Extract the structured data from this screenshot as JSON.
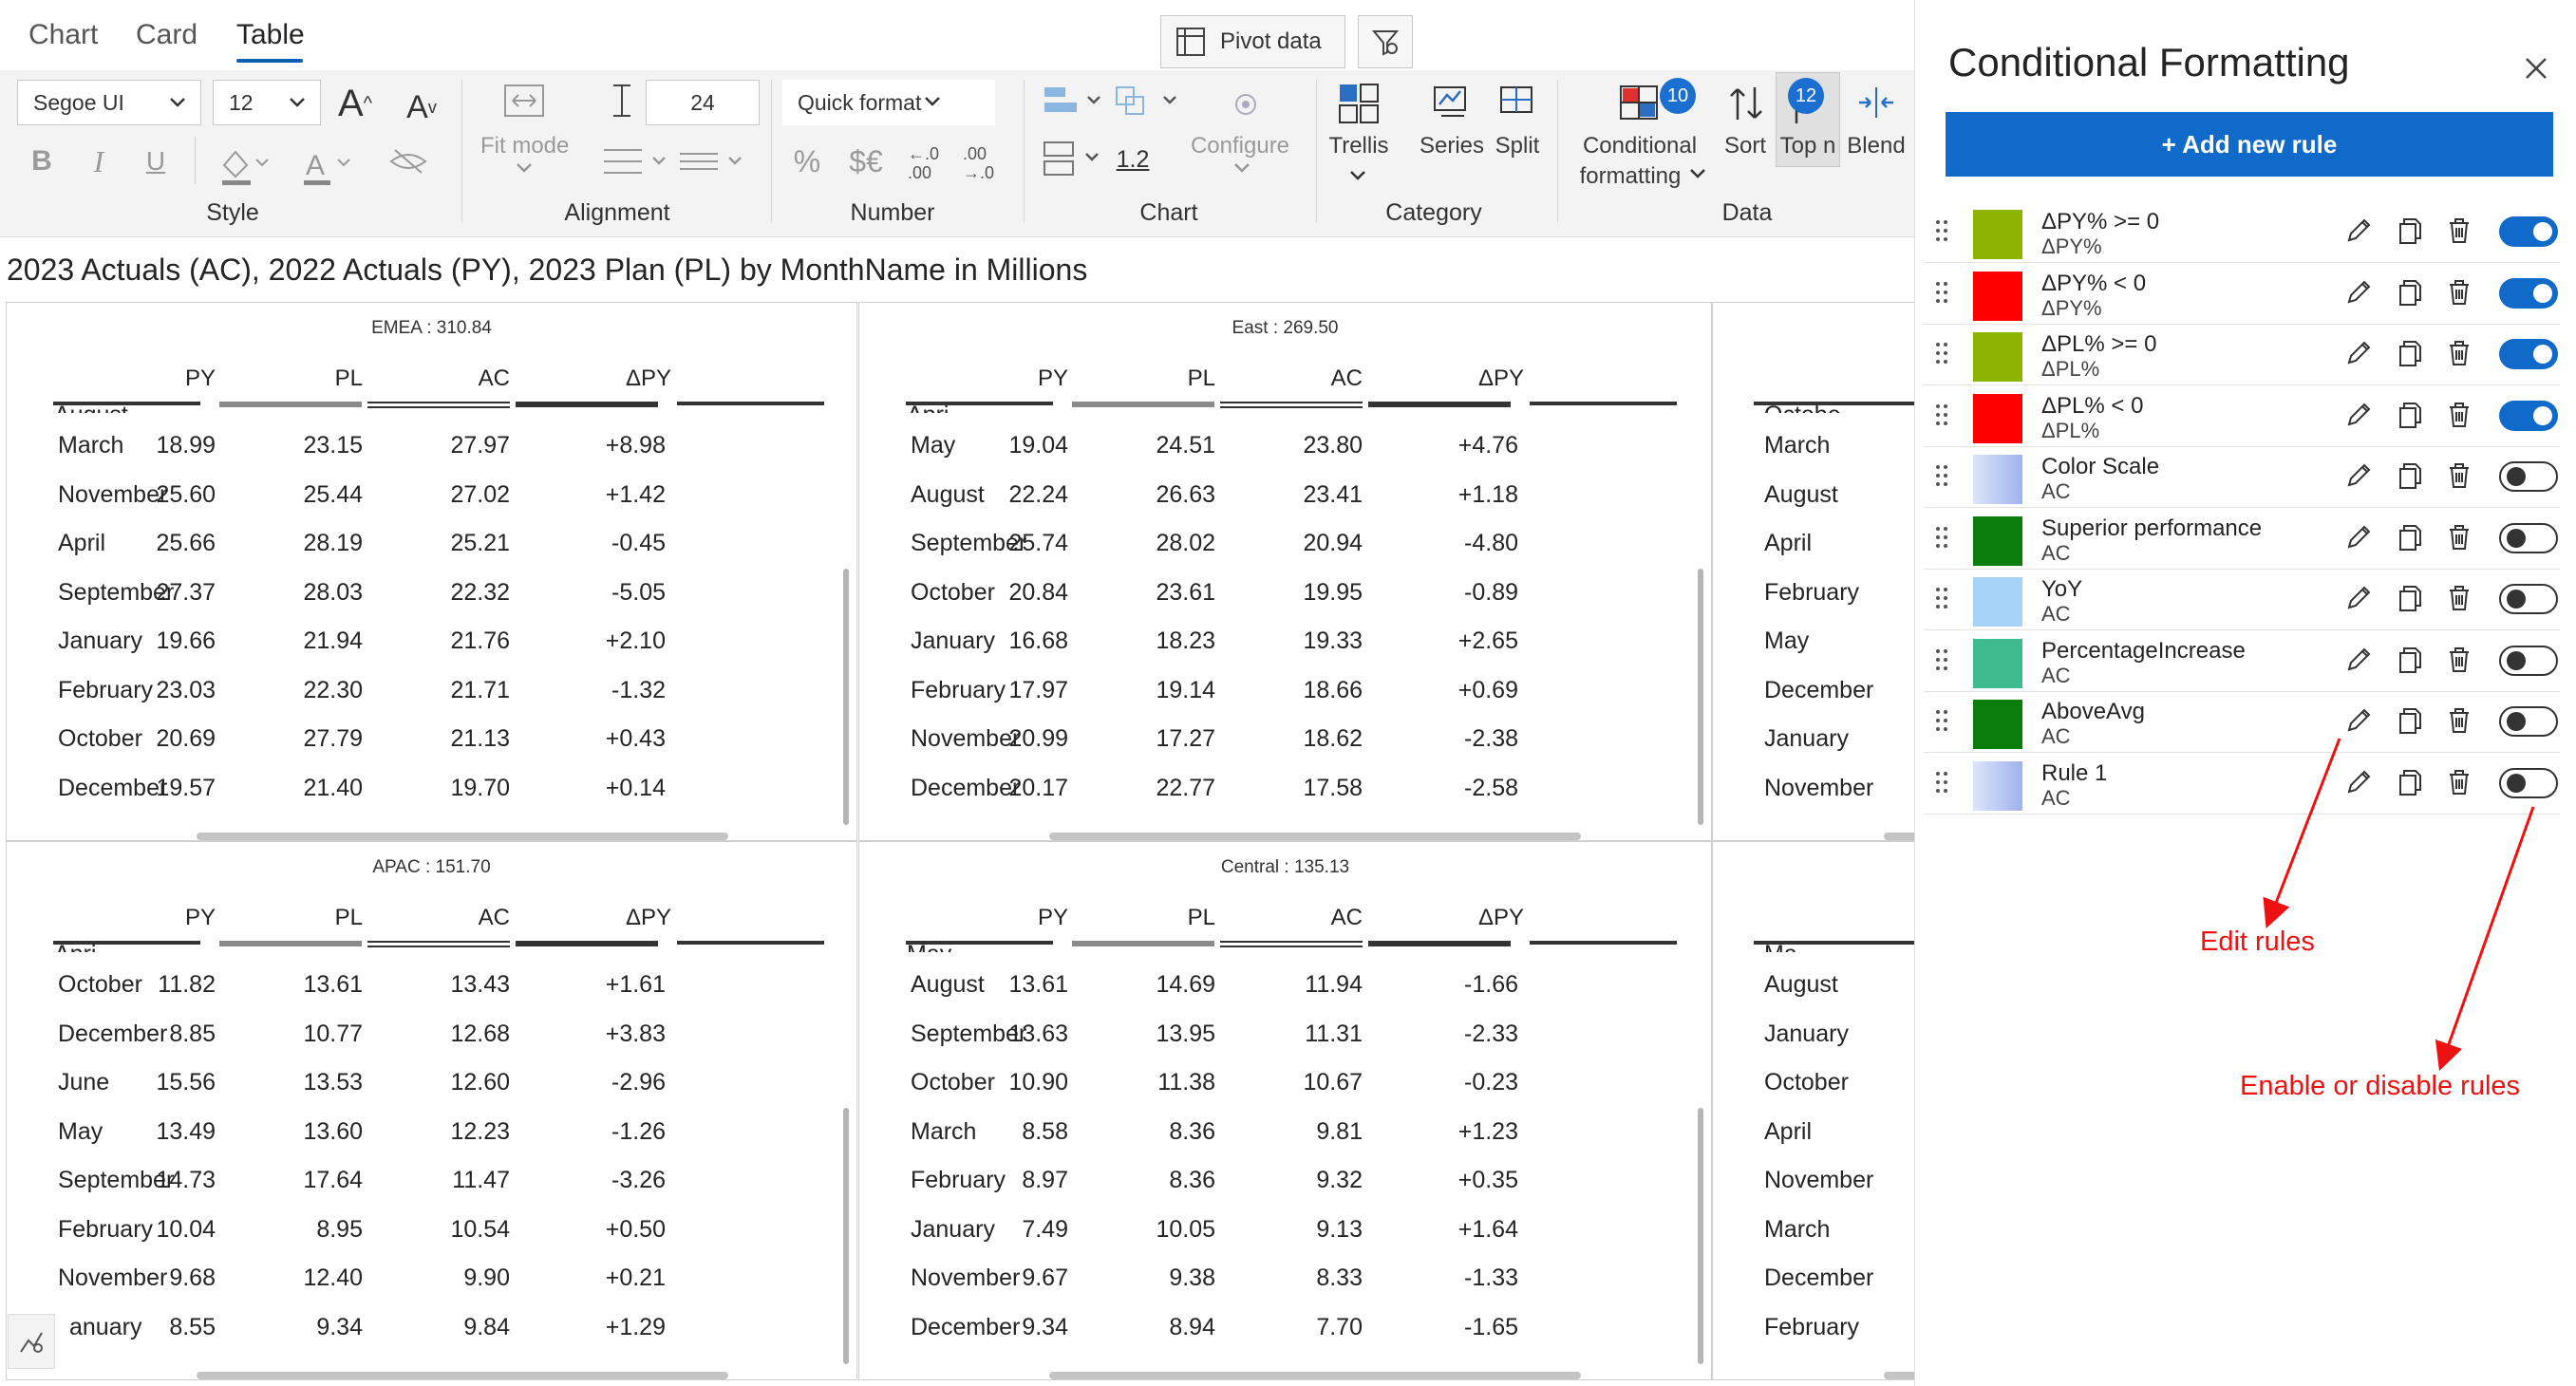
{
  "tabs": [
    {
      "label": "Chart"
    },
    {
      "label": "Card"
    },
    {
      "label": "Table"
    }
  ],
  "ribbon": {
    "pivot_label": "Pivot data",
    "font_family": "Segoe UI",
    "font_size": "12",
    "row_height": "24",
    "quick_format": "Quick format",
    "decimal_value": "1.2",
    "fit_mode": "Fit mode",
    "configure": "Configure",
    "trellis": "Trellis",
    "series": "Series",
    "split": "Split",
    "conditional_formatting": "Conditional",
    "conditional_formatting_2": "formatting",
    "sort": "Sort",
    "top_n": "Top n",
    "blend": "Blend",
    "cf_badge": "10",
    "topn_badge": "12",
    "groups": {
      "style": "Style",
      "alignment": "Alignment",
      "number": "Number",
      "chart": "Chart",
      "category": "Category",
      "data": "Data"
    }
  },
  "title": "2023 Actuals (AC), 2022 Actuals (PY), 2023 Plan (PL) by MonthName in Millions",
  "columns": [
    "PY",
    "PL",
    "AC",
    "ΔPY"
  ],
  "panels": [
    {
      "title": "EMEA :  310.84",
      "rows": [
        [
          "March",
          "18.99",
          "23.15",
          "27.97",
          "+8.98"
        ],
        [
          "November",
          "25.60",
          "25.44",
          "27.02",
          "+1.42"
        ],
        [
          "April",
          "25.66",
          "28.19",
          "25.21",
          "-0.45"
        ],
        [
          "September",
          "27.37",
          "28.03",
          "22.32",
          "-5.05"
        ],
        [
          "January",
          "19.66",
          "21.94",
          "21.76",
          "+2.10"
        ],
        [
          "February",
          "23.03",
          "22.30",
          "21.71",
          "-1.32"
        ],
        [
          "October",
          "20.69",
          "27.79",
          "21.13",
          "+0.43"
        ],
        [
          "December",
          "19.57",
          "21.40",
          "19.70",
          "+0.14"
        ]
      ]
    },
    {
      "title": "East :  269.50",
      "rows": [
        [
          "May",
          "19.04",
          "24.51",
          "23.80",
          "+4.76"
        ],
        [
          "August",
          "22.24",
          "26.63",
          "23.41",
          "+1.18"
        ],
        [
          "September",
          "25.74",
          "28.02",
          "20.94",
          "-4.80"
        ],
        [
          "October",
          "20.84",
          "23.61",
          "19.95",
          "-0.89"
        ],
        [
          "January",
          "16.68",
          "18.23",
          "19.33",
          "+2.65"
        ],
        [
          "February",
          "17.97",
          "19.14",
          "18.66",
          "+0.69"
        ],
        [
          "November",
          "20.99",
          "17.27",
          "18.62",
          "-2.38"
        ],
        [
          "December",
          "20.17",
          "22.77",
          "17.58",
          "-2.58"
        ]
      ]
    },
    {
      "title": "APAC :  151.70",
      "rows": [
        [
          "October",
          "11.82",
          "13.61",
          "13.43",
          "+1.61"
        ],
        [
          "December",
          "8.85",
          "10.77",
          "12.68",
          "+3.83"
        ],
        [
          "June",
          "15.56",
          "13.53",
          "12.60",
          "-2.96"
        ],
        [
          "May",
          "13.49",
          "13.60",
          "12.23",
          "-1.26"
        ],
        [
          "September",
          "14.73",
          "17.64",
          "11.47",
          "-3.26"
        ],
        [
          "February",
          "10.04",
          "8.95",
          "10.54",
          "+0.50"
        ],
        [
          "November",
          "9.68",
          "12.40",
          "9.90",
          "+0.21"
        ],
        [
          "anuary",
          "8.55",
          "9.34",
          "9.84",
          "+1.29"
        ]
      ]
    },
    {
      "title": "Central :  135.13",
      "rows": [
        [
          "August",
          "13.61",
          "14.69",
          "11.94",
          "-1.66"
        ],
        [
          "September",
          "13.63",
          "13.95",
          "11.31",
          "-2.33"
        ],
        [
          "October",
          "10.90",
          "11.38",
          "10.67",
          "-0.23"
        ],
        [
          "March",
          "8.58",
          "8.36",
          "9.81",
          "+1.23"
        ],
        [
          "February",
          "8.97",
          "8.36",
          "9.32",
          "+0.35"
        ],
        [
          "January",
          "7.49",
          "10.05",
          "9.13",
          "+1.64"
        ],
        [
          "November",
          "9.67",
          "9.38",
          "8.33",
          "-1.33"
        ],
        [
          "December",
          "9.34",
          "8.94",
          "7.70",
          "-1.65"
        ]
      ]
    }
  ],
  "partial_panels": [
    {
      "rows": [
        "March",
        "August",
        "April",
        "February",
        "May",
        "December",
        "January",
        "November"
      ]
    },
    {
      "rows": [
        "August",
        "January",
        "October",
        "April",
        "November",
        "March",
        "December",
        "February"
      ]
    }
  ],
  "clipped_top": [
    "August",
    "Apri",
    "Apri",
    "May",
    "Octobe",
    "Ma"
  ],
  "cf_panel": {
    "title": "Conditional Formatting",
    "add_label": "+ Add new rule",
    "rules": [
      {
        "name": "ΔPY% >= 0",
        "field": "ΔPY%",
        "color": "#8cb400",
        "enabled": true
      },
      {
        "name": "ΔPY% < 0",
        "field": "ΔPY%",
        "color": "#ff0000",
        "enabled": true
      },
      {
        "name": "ΔPL% >= 0",
        "field": "ΔPL%",
        "color": "#8cb400",
        "enabled": true
      },
      {
        "name": "ΔPL% < 0",
        "field": "ΔPL%",
        "color": "#ff0000",
        "enabled": true
      },
      {
        "name": "Color Scale",
        "field": "AC",
        "color": "#b8c6f2",
        "enabled": false
      },
      {
        "name": "Superior performance",
        "field": "AC",
        "color": "#0a7d0a",
        "enabled": false
      },
      {
        "name": "YoY",
        "field": "AC",
        "color": "#a6d2f7",
        "enabled": false
      },
      {
        "name": "PercentageIncrease",
        "field": "AC",
        "color": "#3dba8e",
        "enabled": false
      },
      {
        "name": "AboveAvg",
        "field": "AC",
        "color": "#0a7d0a",
        "enabled": false
      },
      {
        "name": "Rule 1",
        "field": "AC",
        "color": "#b8c6f2",
        "enabled": false
      }
    ]
  },
  "annotations": {
    "edit": "Edit rules",
    "enable": "Enable or disable rules"
  }
}
